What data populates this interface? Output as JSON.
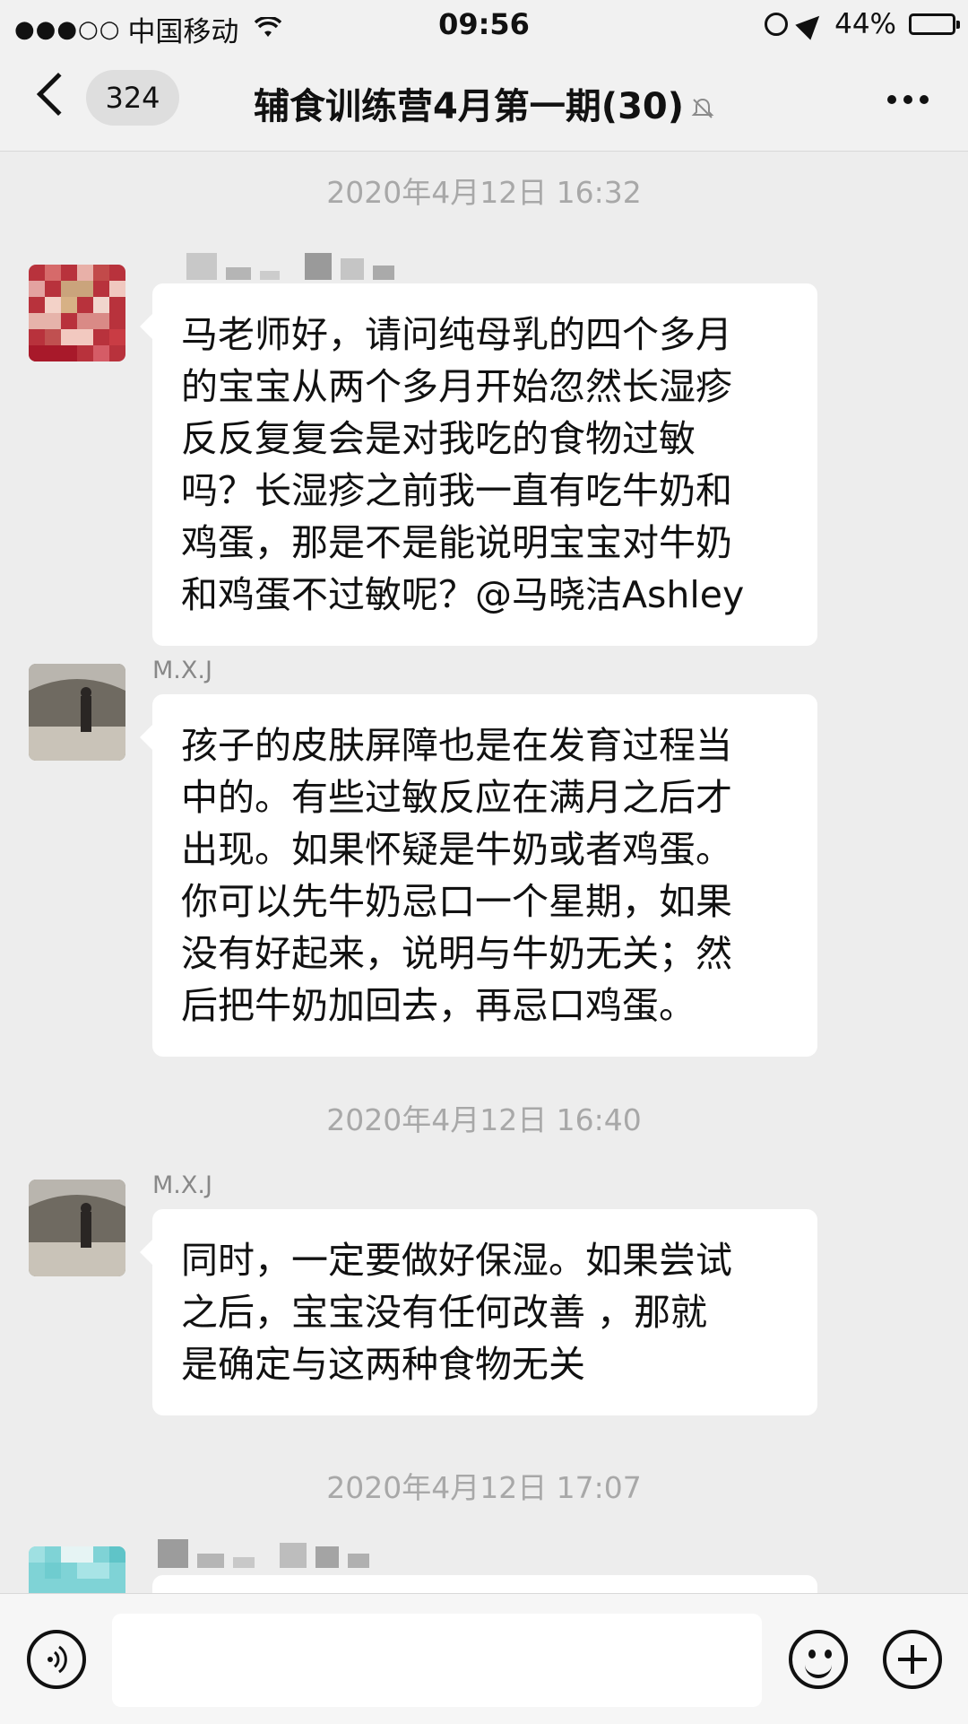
{
  "status_bar": {
    "signal_dots": "●●●○○",
    "carrier": "中国移动",
    "time": "09:56",
    "battery": "44%",
    "battery_level": 0.44
  },
  "nav": {
    "unread_count": "324",
    "title": "辅食训练营4月第一期(30)"
  },
  "messages": [
    {
      "timestamp": "2020年4月12日 16:32"
    },
    {
      "sender": "",
      "text": "马老师好，请问纯母乳的四个多月\n的宝宝从两个多月开始忽然长湿疹\n反反复复会是对我吃的食物过敏\n吗？长湿疹之前我一直有吃牛奶和\n鸡蛋，那是不是能说明宝宝对牛奶\n和鸡蛋不过敏呢？@马晓洁Ashley"
    },
    {
      "sender": "M.X.J",
      "text": "孩子的皮肤屏障也是在发育过程当\n中的。有些过敏反应在满月之后才\n出现。如果怀疑是牛奶或者鸡蛋。\n你可以先牛奶忌口一个星期，如果\n没有好起来，说明与牛奶无关；然\n后把牛奶加回去，再忌口鸡蛋。"
    },
    {
      "timestamp": "2020年4月12日 16:40"
    },
    {
      "sender": "M.X.J",
      "text": "同时，一定要做好保湿。如果尝试\n之后，宝宝没有任何改善 ，那就\n是确定与这两种食物无关"
    },
    {
      "timestamp": "2020年4月12日 17:07"
    }
  ],
  "colors": {
    "background": "#ededed",
    "bubble": "#ffffff",
    "timestamp": "#a8a8a8"
  }
}
